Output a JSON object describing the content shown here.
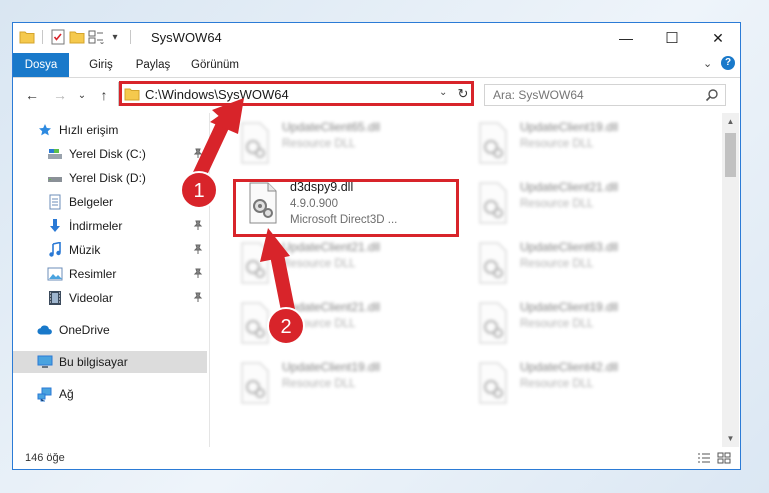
{
  "window": {
    "title": "SysWOW64",
    "controls": {
      "minimize": "—",
      "maximize": "☐",
      "close": "✕"
    }
  },
  "ribbon": {
    "tabs": [
      "Dosya",
      "Giriş",
      "Paylaş",
      "Görünüm"
    ],
    "collapse_glyph": "⌄",
    "help_glyph": "?"
  },
  "navigation": {
    "back": "←",
    "forward": "→",
    "recent": "⌄",
    "up": "↑"
  },
  "address": {
    "path": "C:\\Windows\\SysWOW64",
    "dropdown": "⌄",
    "refresh": "↻"
  },
  "search": {
    "placeholder": "Ara: SysWOW64"
  },
  "sidebar": {
    "items": [
      {
        "label": "Hızlı erişim",
        "icon": "star-icon",
        "pinned": false
      },
      {
        "label": "Yerel Disk (C:)",
        "icon": "drive-icon",
        "pinned": true
      },
      {
        "label": "Yerel Disk (D:)",
        "icon": "drive-icon",
        "pinned": false
      },
      {
        "label": "Belgeler",
        "icon": "documents-icon",
        "pinned": true
      },
      {
        "label": "İndirmeler",
        "icon": "download-icon",
        "pinned": true
      },
      {
        "label": "Müzik",
        "icon": "music-icon",
        "pinned": true
      },
      {
        "label": "Resimler",
        "icon": "pictures-icon",
        "pinned": true
      },
      {
        "label": "Videolar",
        "icon": "videos-icon",
        "pinned": true
      },
      {
        "label": "OneDrive",
        "icon": "cloud-icon",
        "pinned": false
      },
      {
        "label": "Bu bilgisayar",
        "icon": "computer-icon",
        "pinned": false,
        "selected": true
      },
      {
        "label": "Ağ",
        "icon": "network-icon",
        "pinned": false
      }
    ],
    "pin_glyph": "📌"
  },
  "files": [
    {
      "name": "UpdateClient65.dll",
      "desc": "Resource DLL",
      "faded": true
    },
    {
      "name": "UpdateClient19.dll",
      "desc": "Resource DLL",
      "faded": true
    },
    {
      "name": "UpdateClient21.dll",
      "desc": "Resource DLL",
      "faded": true
    },
    {
      "name": "UpdateClient63.dll",
      "desc": "Resource DLL",
      "faded": true
    },
    {
      "name": "UpdateClient21.dll",
      "desc": "Resource DLL",
      "faded": true
    },
    {
      "name": "UpdateClient19.dll",
      "desc": "Resource DLL",
      "faded": true
    },
    {
      "name": "UpdateClient19.dll",
      "desc": "Resource DLL",
      "faded": true
    },
    {
      "name": "UpdateClient42.dll",
      "desc": "Resource DLL",
      "faded": true
    }
  ],
  "highlighted_file": {
    "name": "d3dspy9.dll",
    "version": "4.9.0.900",
    "desc": "Microsoft Direct3D ..."
  },
  "annotations": {
    "step1": "1",
    "step2": "2",
    "color": "#d8242a"
  },
  "status": {
    "count": "146 öğe"
  },
  "colors": {
    "accent": "#1979ca",
    "highlight": "#d8242a",
    "selected": "#dcdcdc"
  }
}
